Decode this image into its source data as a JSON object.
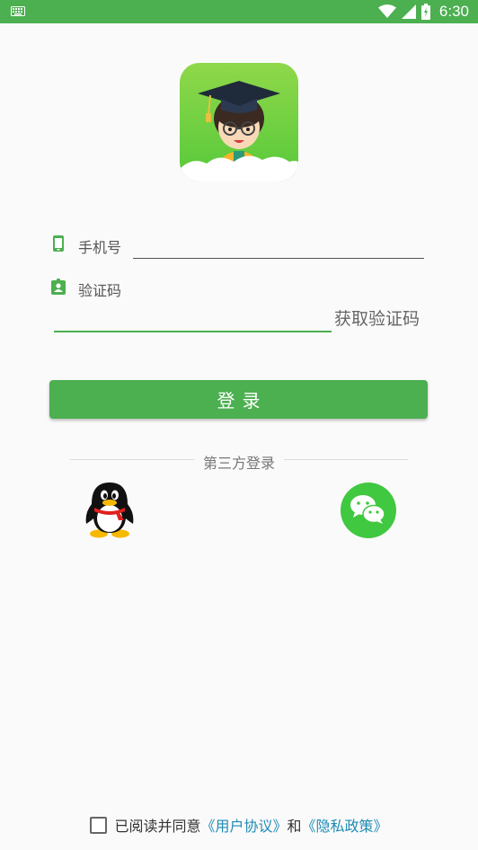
{
  "status_bar": {
    "time": "6:30",
    "color": "#4caf50"
  },
  "form": {
    "phone_label": "手机号",
    "phone_value": "",
    "code_label": "验证码",
    "code_value": "",
    "get_code_label": "获取验证码"
  },
  "login_button": {
    "label": "登录"
  },
  "third_party": {
    "label": "第三方登录"
  },
  "agreement": {
    "prefix": "已阅读并同意",
    "user_agreement": "《用户协议》",
    "and": "和",
    "privacy_policy": "《隐私政策》",
    "checked": false,
    "link_color": "#1e8bb5"
  },
  "accent_color": "#4caf50"
}
